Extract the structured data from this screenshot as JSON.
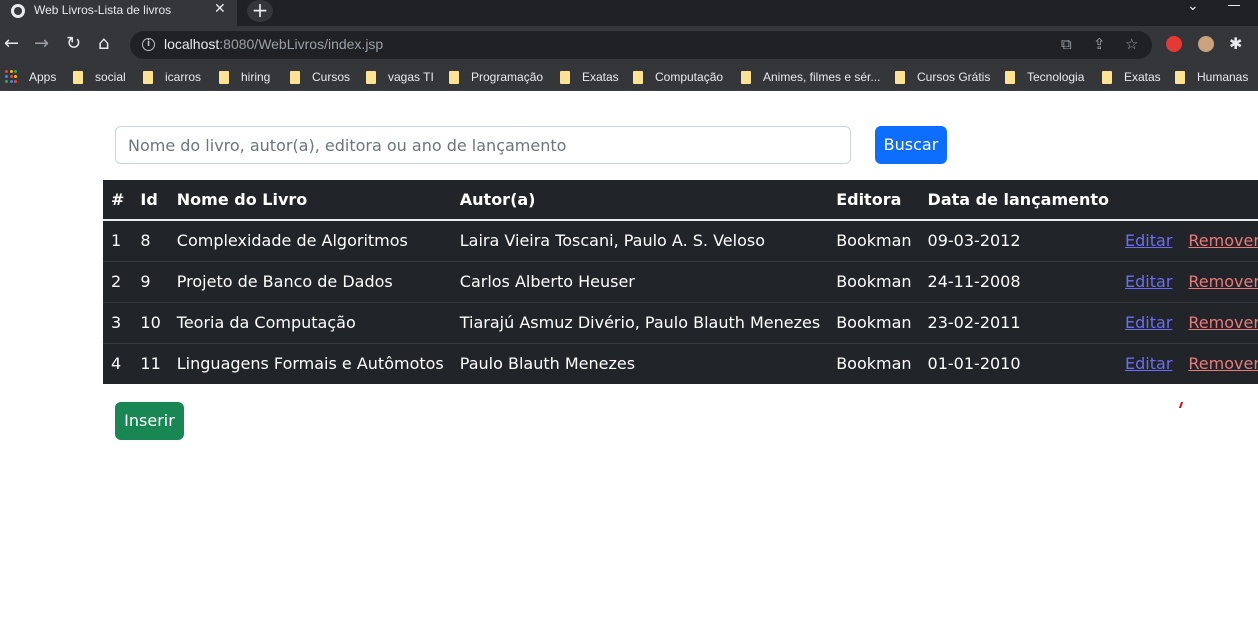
{
  "browser": {
    "tab_title": "Web Livros-Lista de livros",
    "tab_close": "✕",
    "new_tab": "+",
    "url_host": "localhost",
    "url_rest": ":8080/WebLivros/index.jsp",
    "bookmarks": [
      "social",
      "icarros",
      "hiring",
      "Cursos",
      "vagas TI",
      "Programação",
      "Exatas",
      "Computação",
      "Animes, filmes e sér...",
      "Cursos Grátis",
      "Tecnologia",
      "Exatas",
      "Humanas"
    ],
    "apps_label": "Apps"
  },
  "search": {
    "placeholder": "Nome do livro, autor(a), editora ou ano de lançamento",
    "button_label": "Buscar"
  },
  "table": {
    "headers": {
      "index": "#",
      "id": "Id",
      "name": "Nome do Livro",
      "author": "Autor(a)",
      "publisher": "Editora",
      "date": "Data de lançamento"
    },
    "rows": [
      {
        "index": "1",
        "id": "8",
        "name": "Complexidade de Algoritmos",
        "author": "Laira Vieira Toscani, Paulo A. S. Veloso",
        "publisher": "Bookman",
        "date": "09-03-2012",
        "edit": "Editar",
        "remove": "Remover"
      },
      {
        "index": "2",
        "id": "9",
        "name": "Projeto de Banco de Dados",
        "author": "Carlos Alberto Heuser",
        "publisher": "Bookman",
        "date": "24-11-2008",
        "edit": "Editar",
        "remove": "Remover"
      },
      {
        "index": "3",
        "id": "10",
        "name": "Teoria da Computação",
        "author": "Tiarajú Asmuz Divério, Paulo Blauth Menezes",
        "publisher": "Bookman",
        "date": "23-02-2011",
        "edit": "Editar",
        "remove": "Remover"
      },
      {
        "index": "4",
        "id": "11",
        "name": "Linguagens Formais e Autômotos",
        "author": "Paulo Blauth Menezes",
        "publisher": "Bookman",
        "date": "01-01-2010",
        "edit": "Editar",
        "remove": "Remover"
      }
    ]
  },
  "insert_button_label": "Inserir",
  "colors": {
    "primary": "#0d6efd",
    "success": "#198754",
    "table_dark": "#212529"
  }
}
